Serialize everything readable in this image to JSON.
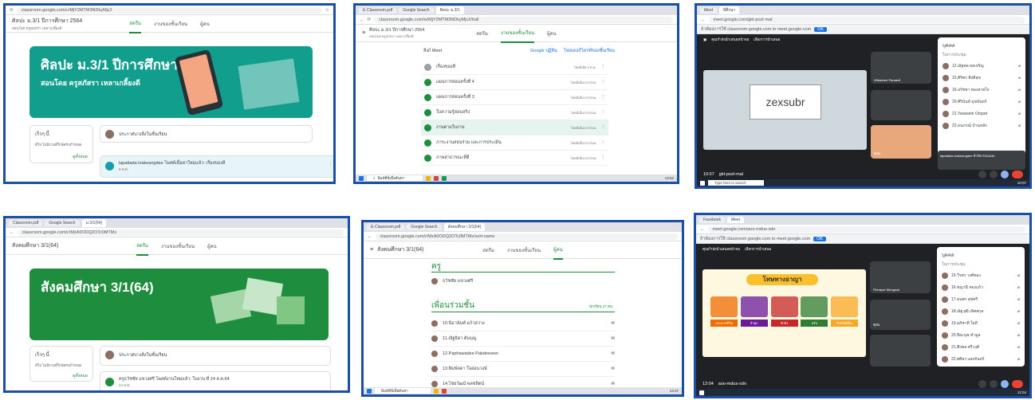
{
  "s1": {
    "tab": "classroom.google.com/c/MjY2MTM3NDkyMjc2",
    "title": "ศิลปะ ม.3/1 ปีการศึกษา 2564",
    "sub": "สอนโดย ครูสภัสรา เหลาเกลี้ยงดี",
    "tabs": [
      "สตรีม",
      "งานของชั้นเรียน",
      "ผู้คน"
    ],
    "banner_title": "ศิลปะ ม.3/1 ปีการศึกษา 2564",
    "banner_sub": "สอนโดย ครูสภัสรา เหลาเกลี้ยงดี",
    "upcoming": "เร็วๆ นี้",
    "upcoming_note": "ดีใจ ไม่มีงานที่ใกล้ครบกำหนด",
    "view_all": "ดูทั้งหมด",
    "share": "ประกาศบางสิ่งในชั้นเรียน",
    "post": "lapattada loakeangdee โพสต์เนื้อหาใหม่แล้ว: เรื่องของสี",
    "post_date": "9 ต.ค."
  },
  "s2": {
    "url": "classroom.google.com/w/MjY2MTM3NDkyMjc2/t/all",
    "title": "ศิลปะ ม.3/1 ปีการศึกษา 2564",
    "sub": "สอนโดย ครูสภัสรา เหลาเกลี้ยงดี",
    "tabs": [
      "สตรีม",
      "งานของชั้นเรียน",
      "ผู้คน"
    ],
    "meet": "ลิงก์ Meet",
    "links": [
      "Google ปฏิทิน",
      "โฟลเดอร์ไดรฟ์ของชั้นเรียน"
    ],
    "items": [
      {
        "t": "เรื่องของสี",
        "d": "โพสต์เมื่อ 9 ต.ค."
      },
      {
        "t": "แผนการสอนครั้งที่ 4",
        "d": "โพสต์เมื่อเวลาก่อน"
      },
      {
        "t": "แผนการสอนครั้งที่ 3",
        "d": "โพสต์เมื่อเวลาก่อน"
      },
      {
        "t": "ใบความรู้สอนจริง",
        "d": "โพสต์เมื่อเวลาก่อน"
      },
      {
        "t": "งานตามใบงาน",
        "d": "โพสต์เมื่อเวลาก่อน"
      },
      {
        "t": "ภาระงานสอนร่วม และการประเมิน",
        "d": "โพสต์เมื่อเวลาก่อน"
      },
      {
        "t": "ภาพสาธารณะที่ดี",
        "d": "โพสต์เมื่อเวลาก่อน"
      }
    ],
    "search": "พิมพ์ที่นี่เพื่อค้นหา",
    "time": "13:52"
  },
  "s3": {
    "tab": "ผีศึกษา",
    "url": "meet.google.com/gkt-pozt-mal",
    "banner": "ถ้าต้องการใช้ classroom.google.com to meet.google.com",
    "share": "คุณกำลังนำเสนอหน้าจอ",
    "present": "เลือกการนำเสนอ",
    "speaker": "Wilasinee Panasrit",
    "big": "zexsubr",
    "you": "คุณ",
    "people": "บุคคล",
    "inmeet": "ในการประชุม",
    "names": [
      "12.ณัฐพล ผลเจริญ",
      "15.ศิริพร ฟังดีสุข",
      "16.อรัชชา ทองสวยใจ",
      "20.ศิรินันท์ มุขจันทร์",
      "21.Yaowarin Ornpet",
      "22.ธนภรณ์ บ้านหลัง"
    ],
    "chat": "lapattada loakeangdee ทำกิจกรรมแนบ",
    "meeting_id": "gkt-pozt-mal",
    "clock": "10:07",
    "search": "Type here to search",
    "time": "10:07"
  },
  "s4": {
    "tab": "ม.3/1(64)",
    "url": "classroom.google.com/c/MzA0ODQ2OTc0MTMx",
    "title": "สังคมศึกษา 3/1(64)",
    "tabs": [
      "สตรีม",
      "งานของชั้นเรียน",
      "ผู้คน"
    ],
    "banner": "สังคมศึกษา 3/1(64)",
    "upcoming": "เร็วๆ นี้",
    "upcoming_note": "ดีใจ ไม่มีงานที่ใกล้ครบกำหนด",
    "view_all": "ดูทั้งหมด",
    "share": "ประกาศบางสิ่งในชั้นเรียน",
    "post": "ครูธวัชชัย แขวงศรี โพสต์งานใหม่แล้ว: ใบงาน ที่ 24 ส.ค.64",
    "post_date": "24 ส.ค."
  },
  "s5": {
    "url": "classroom.google.com/r/MzA0ODQ2OTc0MTMx/sort-name",
    "title": "สังคมศึกษา 3/1(64)",
    "tabs": [
      "สตรีม",
      "งานของชั้นเรียน",
      "ผู้คน"
    ],
    "teachers": "ครู",
    "teacher": "ธวัชชัย แขวงศรี",
    "classmates": "เพื่อนร่วมชั้น",
    "count": "นักเรียน 27 คน",
    "students": [
      "10.นิธานันท์ แก้วสว่าง",
      "11.ณัฐธิดา ต้นบุญ",
      "12.Paphawadee Pakdeewon",
      "13.พิมพ์ลดา ใจอ่อนวงษ์",
      "14.ไชยวัฒน์ พลชลิตน์"
    ],
    "search": "พิมพ์ที่นี่เพื่อค้นหา",
    "time": "13:37"
  },
  "s6": {
    "url": "meet.google.com/aoo-mdus-xdn",
    "banner": "ถ้าต้องการใช้ classroom.google.com to meet.google.com",
    "share": "คุณกำลังนำเสนอหน้าจอ",
    "present": "เลือกการนำเสนอ",
    "slide_title": "โทษทางอาญา",
    "slide_items": [
      "ประหารชีวิต",
      "จำคุก",
      "กักขัง",
      "ปรับ",
      "ริบทรัพย์สิน"
    ],
    "speaker": "Pichayut Wongsuk",
    "you": "คุณ",
    "people": "บุคคล",
    "inmeet": "ในการประชุม",
    "names": [
      "15.วีรศร วงศ์ทอง",
      "16.ชญานี ทองแก้ว",
      "17.ธนพร สุขศรี",
      "18.ณัฐวุฒิ เลิศสกุล",
      "19.อภิชาติ ใจดี",
      "20.ปิยะนุช คำมูล",
      "21.พีรพล ศรีวงศ์",
      "22.ศศิธร แสงจันทร์"
    ],
    "meeting_id": "aoo-mdus-xdn",
    "clock": "12:04",
    "time": "12:04"
  },
  "colors": {
    "border": "#1b4fa3",
    "green": "#1e8e3e",
    "meet": "#202124"
  }
}
